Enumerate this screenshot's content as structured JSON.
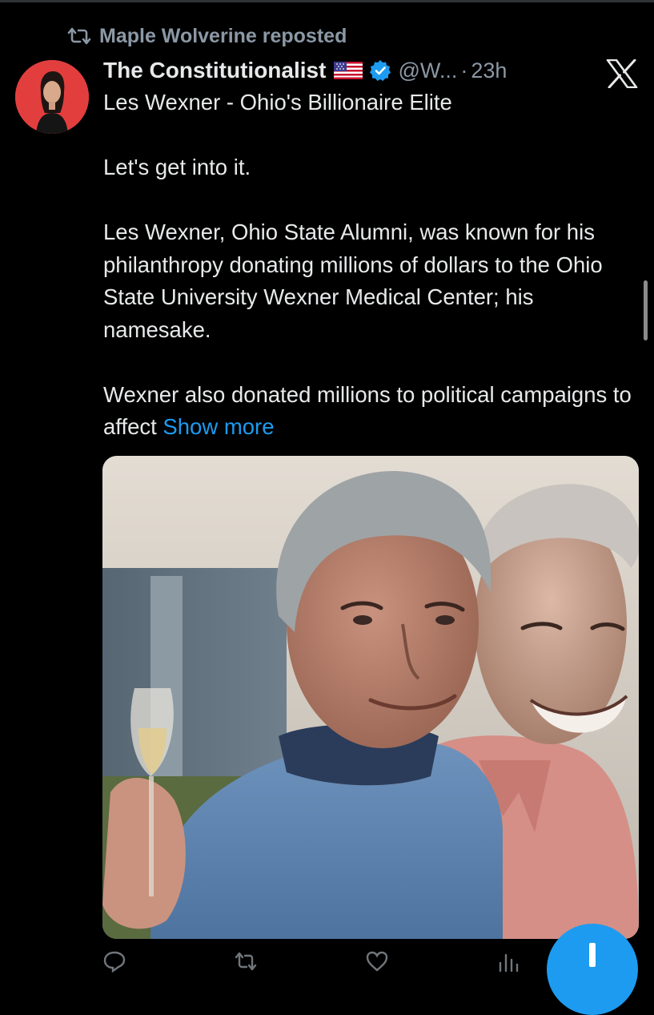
{
  "repost": {
    "text": "Maple Wolverine reposted",
    "icon": "repost-icon"
  },
  "author": {
    "display_name": "The Constitutionalist",
    "flag_icon": "us-flag-icon",
    "verified_icon": "verified-badge-icon",
    "handle": "@W...",
    "separator": "·",
    "time": "23h",
    "avatar": "avatar"
  },
  "tweet": {
    "title_line": "Les Wexner - Ohio's Billionaire Elite",
    "paragraph_1": "Let's get into it.",
    "paragraph_2": "Les Wexner, Ohio State Alumni, was known for his philanthropy donating millions of dollars to the Ohio State University Wexner Medical Center; his namesake.",
    "paragraph_3": "Wexner also donated millions to political campaigns to affect",
    "show_more": "Show more"
  },
  "media": {
    "alt": ""
  },
  "actions": [
    {
      "icon": "reply-icon",
      "count": ""
    },
    {
      "icon": "repost-icon",
      "count": ""
    },
    {
      "icon": "like-icon",
      "count": ""
    },
    {
      "icon": "views-icon",
      "count": ""
    }
  ],
  "branding": {
    "logo": "x-logo"
  },
  "colors": {
    "background": "#000000",
    "text": "#e7e9ea",
    "secondary_text": "#8b98a5",
    "link": "#1d9bf0",
    "verified": "#1d9bf0",
    "avatar_bg": "#e33e3e"
  }
}
